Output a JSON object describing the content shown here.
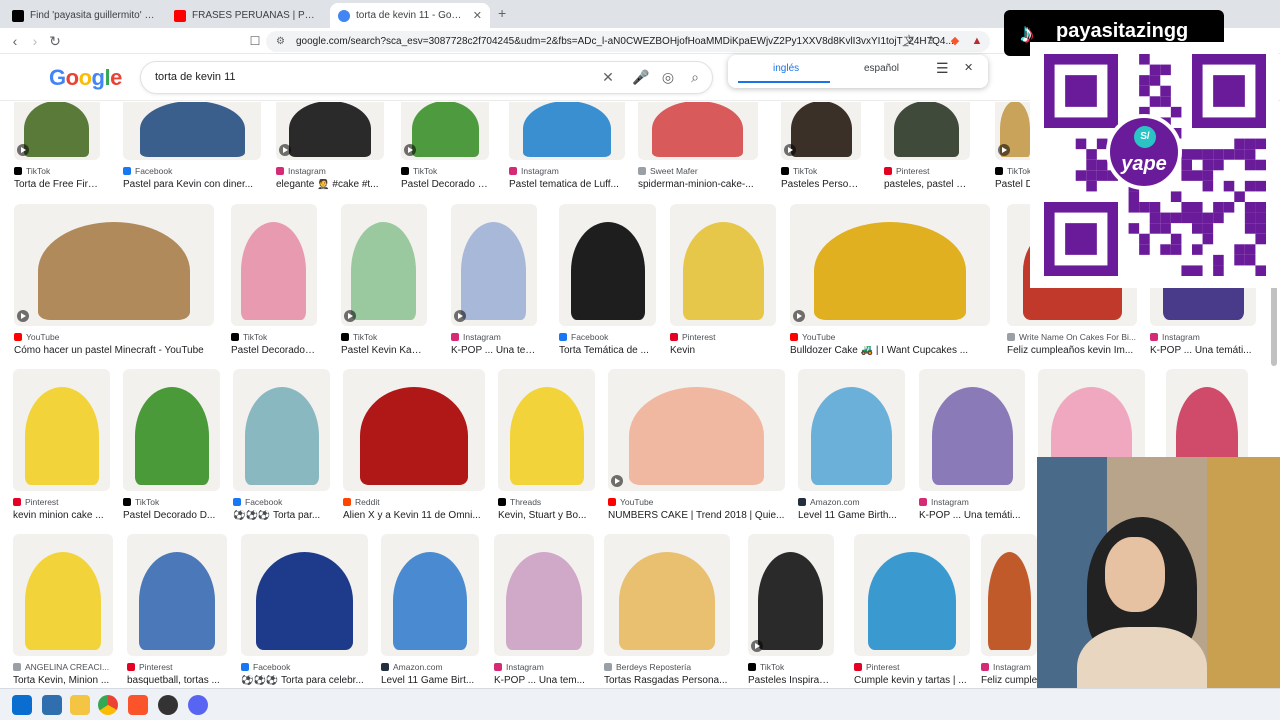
{
  "browser": {
    "tabs": [
      {
        "title": "Find 'payasita guillermito' on TikTok | TikTok",
        "color": "#000000"
      },
      {
        "title": "FRASES PERUANAS | Payasita zing - YouTube",
        "color": "#ff0000"
      },
      {
        "title": "torta de kevin 11 - Google Search",
        "color": "#4285f4"
      }
    ],
    "new_tab": "+",
    "url": "google.com/search?sca_esv=3087728c2f704245&udm=2&fbs=ADc_l-aN0CWEZBOHjofHoaMMDiKpaEWjvZ2Py1XXV8d8KvlI3vxYI1tojT_24H7Q4..."
  },
  "google": {
    "logo": "Google",
    "query": "torta de kevin 11",
    "translate": {
      "lang1": "inglés",
      "lang2": "español"
    }
  },
  "results": [
    [
      {
        "source": "TikTok",
        "title": "Torta de Free Fire:...",
        "color": "#5a7a3a",
        "video": true
      },
      {
        "source": "Facebook",
        "title": "Pastel para Kevin con diner...",
        "color": "#3b5f8c",
        "video": false
      },
      {
        "source": "Instagram",
        "title": "elegante 🤵 #cake #t...",
        "color": "#2a2a2a",
        "video": true
      },
      {
        "source": "TikTok",
        "title": "Pastel Decorado D...",
        "color": "#4e9a3e",
        "video": true
      },
      {
        "source": "Instagram",
        "title": "Pastel tematica de Luff...",
        "color": "#3a8fd0",
        "video": false
      },
      {
        "source": "Sweet Mafer",
        "title": "spiderman-minion-cake-...",
        "color": "#d95a5a",
        "video": false
      },
      {
        "source": "TikTok",
        "title": "Pasteles Personali...",
        "color": "#3a3028",
        "video": true
      },
      {
        "source": "Pinterest",
        "title": "pasteles, pastel cu...",
        "color": "#3f4a3a",
        "video": false
      },
      {
        "source": "TikTok",
        "title": "Pastel D...",
        "color": "#c9a35a",
        "video": true
      }
    ],
    [
      {
        "source": "YouTube",
        "title": "Cómo hacer un pastel Minecraft - YouTube",
        "color": "#b08a5a",
        "video": true
      },
      {
        "source": "TikTok",
        "title": "Pastel Decorado D...",
        "color": "#e89ab0",
        "video": false
      },
      {
        "source": "TikTok",
        "title": "Pastel Kevin Kaarl:...",
        "color": "#9ac9a0",
        "video": true
      },
      {
        "source": "Instagram",
        "title": "K-POP ... Una tem...",
        "color": "#a8b8d8",
        "video": true
      },
      {
        "source": "Facebook",
        "title": "Torta Temática de ...",
        "color": "#1e1e1e",
        "video": false
      },
      {
        "source": "Pinterest",
        "title": "Kevin",
        "color": "#e6c74a",
        "video": false
      },
      {
        "source": "YouTube",
        "title": "Bulldozer Cake 🚜 | I Want Cupcakes ...",
        "color": "#e0b020",
        "video": true
      },
      {
        "source": "Write Name On Cakes For Bi...",
        "title": "Feliz cumpleaños kevin Im...",
        "color": "#c0392b",
        "video": false
      },
      {
        "source": "Instagram",
        "title": "K-POP ... Una temáti...",
        "color": "#4a3a8a",
        "video": false
      }
    ],
    [
      {
        "source": "Pinterest",
        "title": "kevin minion cake ...",
        "color": "#f2d43a",
        "video": false
      },
      {
        "source": "TikTok",
        "title": "Pastel Decorado D...",
        "color": "#4a9a3a",
        "video": false
      },
      {
        "source": "Facebook",
        "title": "⚽⚽⚽ Torta par...",
        "color": "#8ab8c0",
        "video": false
      },
      {
        "source": "Reddit",
        "title": "Alien X y a Kevin 11 de Omni...",
        "color": "#b01818",
        "video": false
      },
      {
        "source": "Threads",
        "title": "Kevin, Stuart y Bo...",
        "color": "#f2d43a",
        "video": false
      },
      {
        "source": "YouTube",
        "title": "NUMBERS CAKE | Trend 2018 | Quie...",
        "color": "#f0b8a0",
        "video": true
      },
      {
        "source": "Amazon.com",
        "title": "Level 11 Game Birth...",
        "color": "#6ab0d8",
        "video": false
      },
      {
        "source": "Instagram",
        "title": "K-POP ... Una temáti...",
        "color": "#8a7ab8",
        "video": false
      },
      {
        "source": "",
        "title": "",
        "color": "#f0a8c0",
        "video": false
      },
      {
        "source": "",
        "title": "",
        "color": "#d04a6a",
        "video": false
      }
    ],
    [
      {
        "source": "ANGELINA CREACI...",
        "title": "Torta Kevin, Minion ...",
        "color": "#f2d43a",
        "video": false
      },
      {
        "source": "Pinterest",
        "title": "basquetball, tortas ...",
        "color": "#4a78b8",
        "video": false
      },
      {
        "source": "Facebook",
        "title": "⚽⚽⚽ Torta para celebr...",
        "color": "#1e3a8a",
        "video": false
      },
      {
        "source": "Amazon.com",
        "title": "Level 11 Game Birt...",
        "color": "#4a8ad0",
        "video": false
      },
      {
        "source": "Instagram",
        "title": "K-POP ... Una tem...",
        "color": "#d0a8c8",
        "video": false
      },
      {
        "source": "Berdeys Repostería",
        "title": "Tortas Rasgadas Persona...",
        "color": "#e8c070",
        "video": false
      },
      {
        "source": "TikTok",
        "title": "Pasteles Inspirado...",
        "color": "#2a2a2a",
        "video": true
      },
      {
        "source": "Pinterest",
        "title": "Cumple kevin y tartas | ...",
        "color": "#3a9ad0",
        "video": false
      },
      {
        "source": "Instagram",
        "title": "Feliz cumple...",
        "color": "#c05a2a",
        "video": false
      }
    ]
  ],
  "overlay": {
    "tiktok_handle": "payasitazingg",
    "qr_brand": "yape",
    "qr_badge_letter": "S/"
  },
  "colors": {
    "accent": "#1a73e8",
    "qr": "#6a1b9a"
  }
}
